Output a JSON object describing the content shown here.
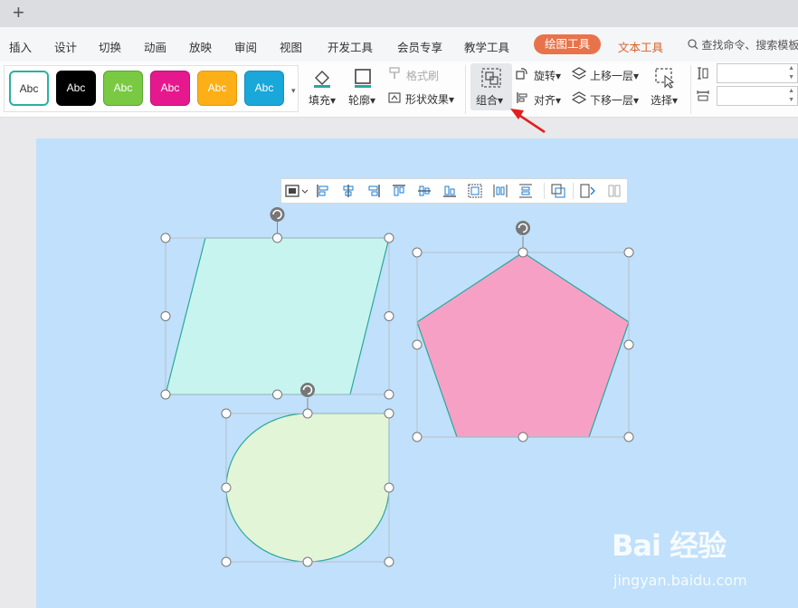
{
  "titlebar": {
    "new_tab_label": "+"
  },
  "menu": {
    "items": [
      "插入",
      "设计",
      "切换",
      "动画",
      "放映",
      "审阅",
      "视图",
      "开发工具",
      "会员专享",
      "教学工具"
    ],
    "drawing_tools": "绘图工具",
    "text_tools": "文本工具",
    "search_placeholder": "查找命令、搜索模板"
  },
  "ribbon": {
    "styles": [
      {
        "label": "Abc",
        "bg": "#ffffff",
        "fg": "#333333",
        "border": "#2ab1a0"
      },
      {
        "label": "Abc",
        "bg": "#000000",
        "fg": "#ffffff",
        "border": "#000000"
      },
      {
        "label": "Abc",
        "bg": "#7ac943",
        "fg": "#ffffff",
        "border": "#5aa532"
      },
      {
        "label": "Abc",
        "bg": "#e5198d",
        "fg": "#ffffff",
        "border": "#c0117a"
      },
      {
        "label": "Abc",
        "bg": "#fcaf17",
        "fg": "#ffffff",
        "border": "#e09a10"
      },
      {
        "label": "Abc",
        "bg": "#1aa7d9",
        "fg": "#ffffff",
        "border": "#1590bc"
      }
    ],
    "fill": "填充",
    "outline": "轮廓",
    "format_painter": "格式刷",
    "shape_effects": "形状效果",
    "group": "组合",
    "rotate": "旋转",
    "align": "对齐",
    "bring_forward": "上移一层",
    "send_backward": "下移一层",
    "select": "选择"
  },
  "watermark": {
    "logo": "Bai 经验",
    "url": "jingyan.baidu.com"
  },
  "colors": {
    "parallelogram_fill": "#c8f4f0",
    "pentagon_fill": "#f7a0c6",
    "teardrop_fill": "#e3f5d7",
    "shape_stroke": "#2aa89a",
    "slide_bg": "#c0e0fb",
    "arrow_red": "#e02020",
    "accent_orange": "#e8734a"
  }
}
